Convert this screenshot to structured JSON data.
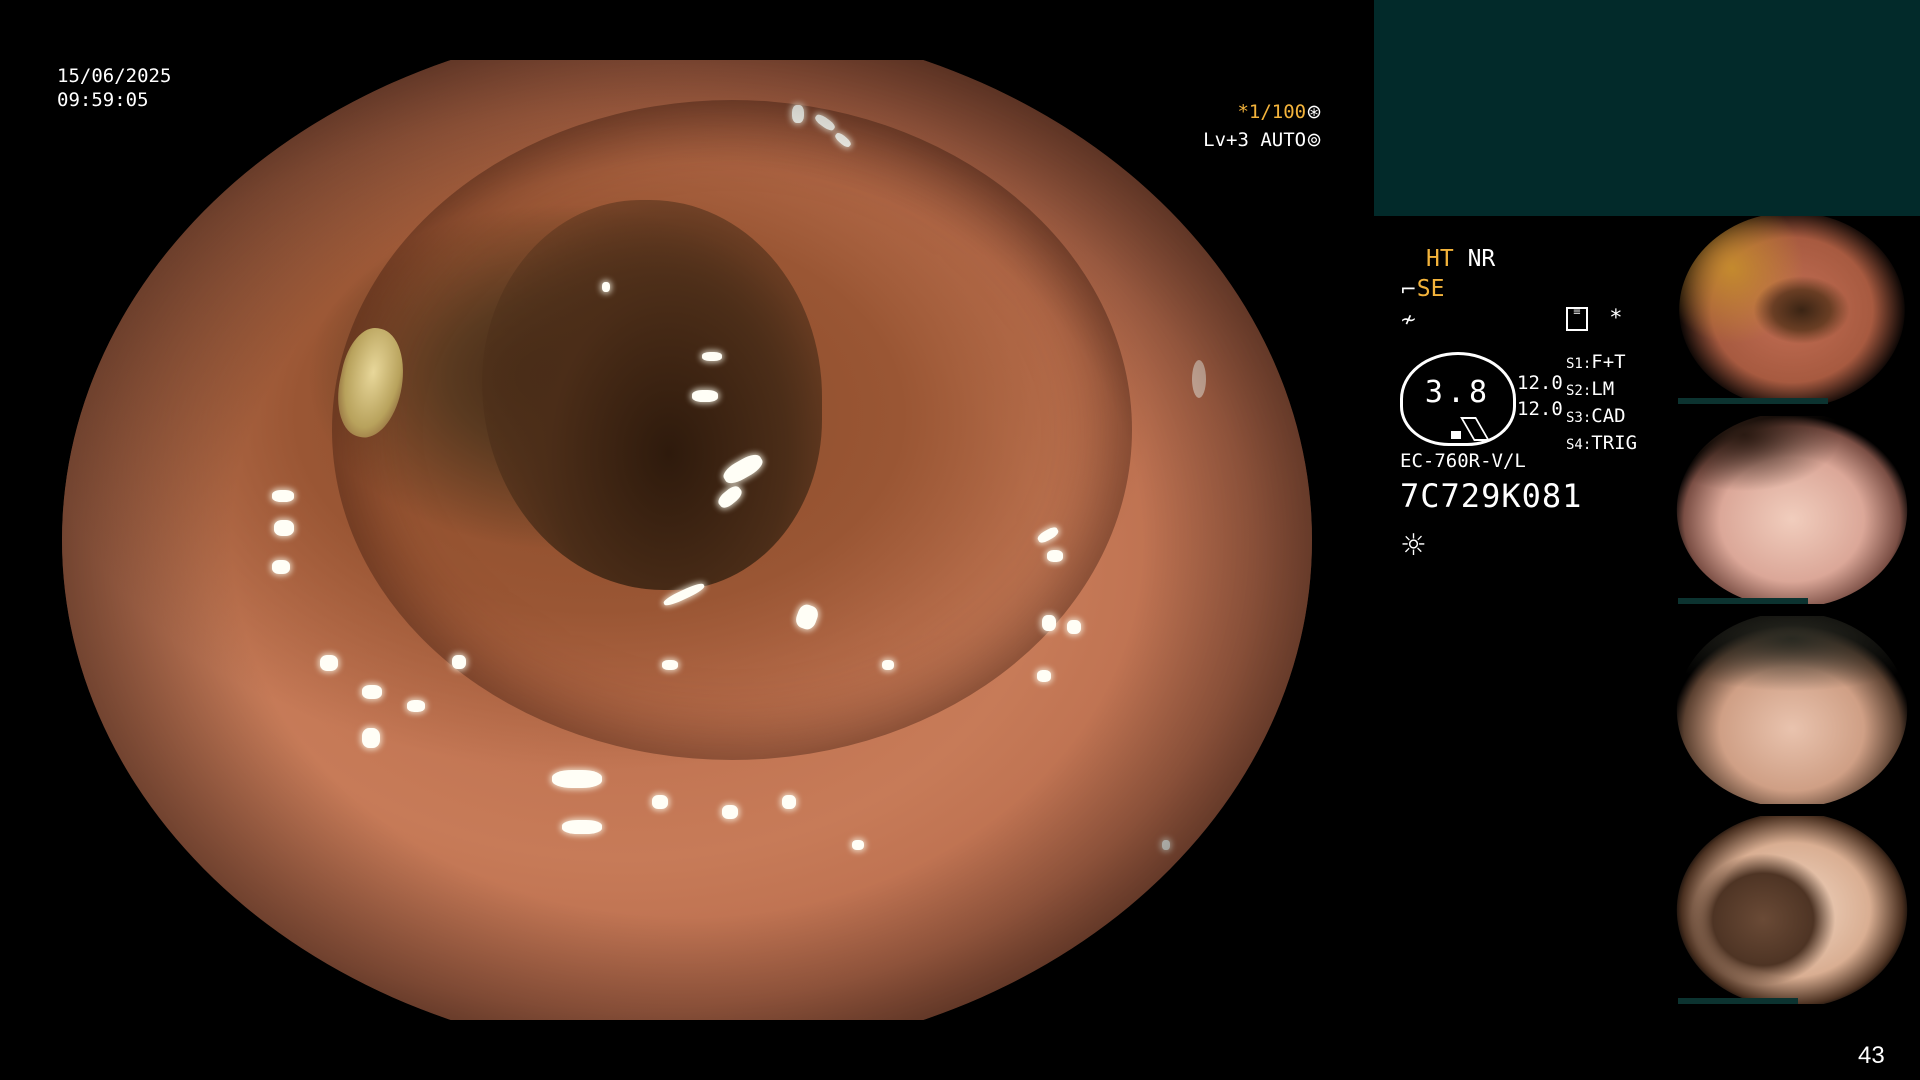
{
  "timestamp": {
    "date": "15/06/2025",
    "time": "09:59:05"
  },
  "shutter": {
    "value": "*1/100",
    "icon": "aperture-icon"
  },
  "brightness": {
    "value": "Lv+3 AUTO",
    "icon": "iris-icon"
  },
  "modes": {
    "ht": "HT",
    "nr": "NR",
    "se": "SE",
    "se_icon": "structure-enhance-icon",
    "filter_icon": "filter-icon",
    "record_icon": "record-icon",
    "star": "*"
  },
  "magnification": {
    "value": "3.8",
    "near": "12.0",
    "far": "12.0"
  },
  "switches": [
    {
      "key": "S1",
      "value": "F+T"
    },
    {
      "key": "S2",
      "value": "LM"
    },
    {
      "key": "S3",
      "value": "CAD"
    },
    {
      "key": "S4",
      "value": "TRIG"
    }
  ],
  "scope": {
    "model": "EC-760R-V/L",
    "serial": "7C729K081"
  },
  "light_icon": "light-source-icon",
  "thumbnail_count": "4",
  "frame_number": "43",
  "colors": {
    "amber": "#f3b33b",
    "panel": "#022a2a",
    "text": "#ffffff"
  }
}
